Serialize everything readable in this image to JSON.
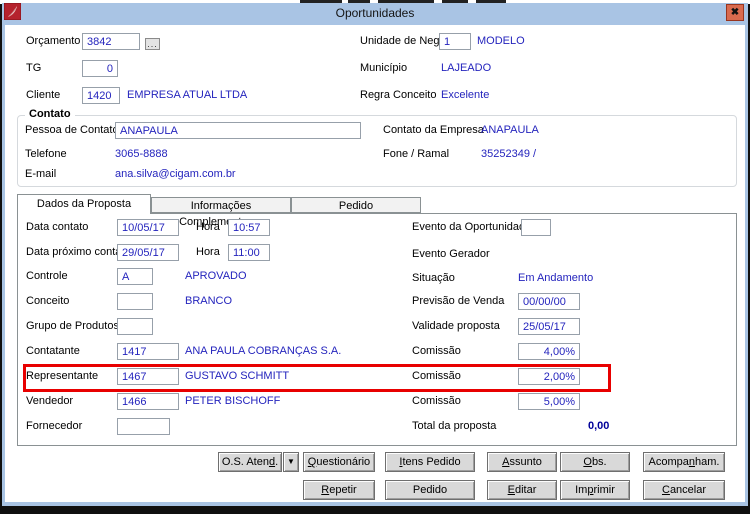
{
  "colors": {
    "titlebar_blue": "#a9c4e4",
    "close_button_red": "#d96a4e",
    "value_text_blue": "#2424bd",
    "highlight_red": "#e80000",
    "app_icon_red": "#b5222d"
  },
  "window": {
    "title": "Oportunidades",
    "close_glyph": "✖"
  },
  "header": {
    "orcamento": {
      "label": "Orçamento",
      "value": "3842",
      "lookup": "..."
    },
    "tg": {
      "label": "TG",
      "value": "0"
    },
    "cliente": {
      "label": "Cliente",
      "value": "1420",
      "name": "EMPRESA ATUAL LTDA"
    },
    "unidade": {
      "label": "Unidade de Neg.",
      "value": "1",
      "name": "MODELO"
    },
    "municipio": {
      "label": "Município",
      "value": "LAJEADO"
    },
    "regra_conceito": {
      "label": "Regra Conceito",
      "value": "Excelente"
    }
  },
  "contato": {
    "legend": "Contato",
    "pessoa": {
      "label": "Pessoa de Contato",
      "value": "ANAPAULA"
    },
    "telefone": {
      "label": "Telefone",
      "value": "3065-8888"
    },
    "email": {
      "label": "E-mail",
      "value": "ana.silva@cigam.com.br"
    },
    "contato_empresa": {
      "label": "Contato da Empresa",
      "value": "ANAPAULA"
    },
    "fone_ramal": {
      "label": "Fone / Ramal",
      "value": "35252349 /"
    }
  },
  "tabs": [
    {
      "label": "Dados da Proposta"
    },
    {
      "label": "Informações Complementares"
    },
    {
      "label": "Pedido"
    }
  ],
  "proposta": {
    "data_contato": {
      "label": "Data contato",
      "value": "10/05/17",
      "hora_label": "Hora",
      "hora": "10:57"
    },
    "data_proximo": {
      "label": "Data próximo contato",
      "value": "29/05/17",
      "hora_label": "Hora",
      "hora": "11:00"
    },
    "controle": {
      "label": "Controle",
      "value": "A",
      "desc": "APROVADO"
    },
    "conceito": {
      "label": "Conceito",
      "value": "",
      "desc": "BRANCO"
    },
    "grupo_produtos": {
      "label": "Grupo de Produtos",
      "value": ""
    },
    "contatante": {
      "label": "Contatante",
      "value": "1417",
      "desc": "ANA PAULA COBRANÇAS S.A.",
      "comissao_label": "Comissão",
      "comissao": "4,00%"
    },
    "representante": {
      "label": "Representante",
      "value": "1467",
      "desc": "GUSTAVO SCHMITT",
      "comissao_label": "Comissão",
      "comissao": "2,00%"
    },
    "vendedor": {
      "label": "Vendedor",
      "value": "1466",
      "desc": "PETER BISCHOFF",
      "comissao_label": "Comissão",
      "comissao": "5,00%"
    },
    "fornecedor": {
      "label": "Fornecedor",
      "value": ""
    },
    "evento_oportunidade": {
      "label": "Evento da Oportunidade",
      "value": ""
    },
    "evento_gerador": {
      "label": "Evento Gerador"
    },
    "situacao": {
      "label": "Situação",
      "value": "Em Andamento"
    },
    "previsao_venda": {
      "label": "Previsão de Venda",
      "value": "00/00/00"
    },
    "validade_proposta": {
      "label": "Validade proposta",
      "value": "25/05/17"
    },
    "total": {
      "label": "Total da proposta",
      "value": "0,00"
    }
  },
  "footer": {
    "dropdown_glyph": "▼",
    "os_atend": {
      "label": "O.S. Atend.",
      "accel": 9
    },
    "questionario": {
      "label": "Questionário",
      "accel": 0
    },
    "itens_pedido": {
      "label": "Itens Pedido",
      "accel": 0
    },
    "assunto": {
      "label": "Assunto",
      "accel": 0
    },
    "obs": {
      "label": "Obs.",
      "accel": 0
    },
    "acompanham": {
      "label": "Acompanham.",
      "accel": 6
    },
    "repetir": {
      "label": "Repetir",
      "accel": 0
    },
    "pedido": {
      "label": "Pedido",
      "accel": -1
    },
    "editar": {
      "label": "Editar",
      "accel": 0
    },
    "imprimir": {
      "label": "Imprimir",
      "accel": 2
    },
    "cancelar": {
      "label": "Cancelar",
      "accel": 0
    }
  }
}
